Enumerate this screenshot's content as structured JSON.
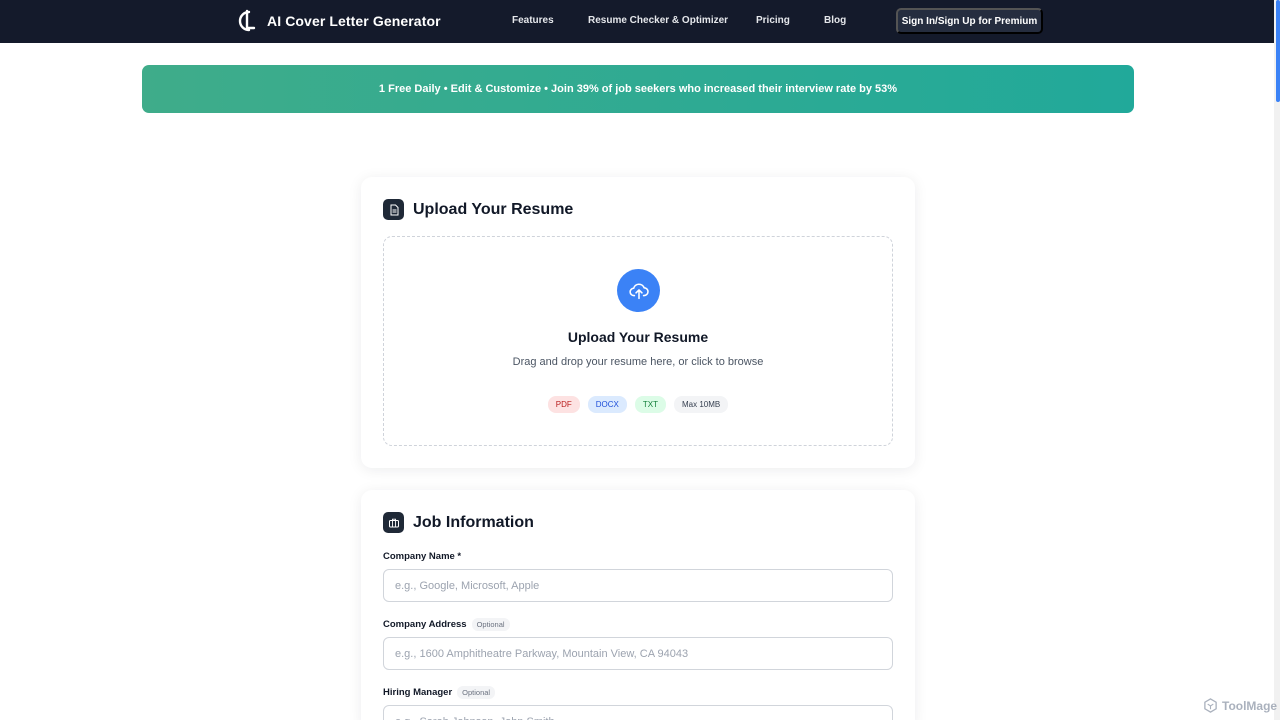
{
  "nav": {
    "brand_title": "AI Cover Letter Generator",
    "links": [
      {
        "label": "Features"
      },
      {
        "label": "Resume Checker & Optimizer"
      },
      {
        "label": "Pricing"
      },
      {
        "label": "Blog"
      }
    ],
    "cta_label": "Sign In/Sign Up for Premium"
  },
  "promo": {
    "text": "1 Free Daily • Edit & Customize • Join 39% of job seekers who increased their interview rate by 53%"
  },
  "upload_card": {
    "title": "Upload Your Resume",
    "icon": "document-icon",
    "dropzone": {
      "icon": "cloud-upload-icon",
      "title": "Upload Your Resume",
      "subtitle": "Drag and drop your resume here, or click to browse",
      "formats": [
        "PDF",
        "DOCX",
        "TXT",
        "Max 10MB"
      ]
    }
  },
  "job_card": {
    "title": "Job Information",
    "icon": "briefcase-icon",
    "fields": [
      {
        "label": "Company Name *",
        "optional": "",
        "placeholder": "e.g., Google, Microsoft, Apple",
        "value": ""
      },
      {
        "label": "Company Address",
        "optional": "Optional",
        "placeholder": "e.g., 1600 Amphitheatre Parkway, Mountain View, CA 94043",
        "value": ""
      },
      {
        "label": "Hiring Manager",
        "optional": "Optional",
        "placeholder": "e.g., Sarah Johnson, John Smith",
        "value": ""
      }
    ]
  },
  "watermark": {
    "text": "ToolMage"
  },
  "colors": {
    "navbar": "#141a2b",
    "accent": "#3b82f6",
    "promo_start": "#3fac8a",
    "promo_end": "#21a99a",
    "cta": "#252d3f"
  }
}
